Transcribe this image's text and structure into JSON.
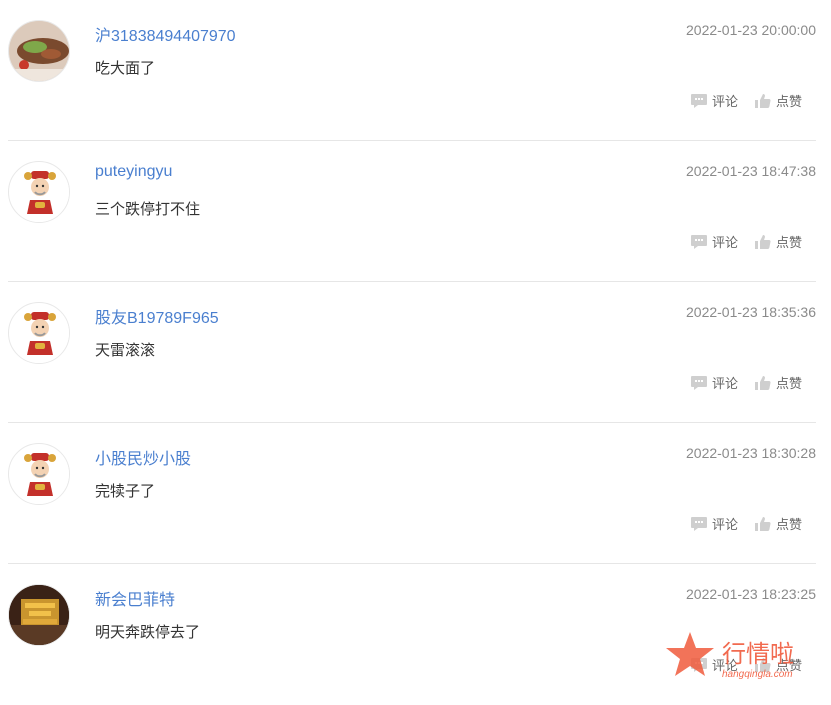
{
  "comments": [
    {
      "username": "沪31838494407970",
      "timestamp": "2022-01-23 20:00:00",
      "content": "吃大面了",
      "avatar": "food-photo"
    },
    {
      "username": "puteyingyu",
      "timestamp": "2022-01-23 18:47:38",
      "content": "三个跌停打不住",
      "avatar": "caishen-cartoon"
    },
    {
      "username": "股友B19789F965",
      "timestamp": "2022-01-23 18:35:36",
      "content": "天雷滚滚",
      "avatar": "caishen-cartoon"
    },
    {
      "username": "小股民炒小股",
      "timestamp": "2022-01-23 18:30:28",
      "content": "完犊子了",
      "avatar": "caishen-cartoon"
    },
    {
      "username": "新会巴菲特",
      "timestamp": "2022-01-23 18:23:25",
      "content": "明天奔跌停去了",
      "avatar": "fox-logo"
    }
  ],
  "actions": {
    "comment_label": "评论",
    "like_label": "点赞"
  },
  "watermark": {
    "title": "行情啦",
    "url": "hangqingla.com"
  },
  "colors": {
    "username": "#4a7fcf",
    "timestamp": "#8a8a8a",
    "content": "#333333",
    "divider": "#e6e6e6",
    "watermark": "#f05a3c"
  }
}
